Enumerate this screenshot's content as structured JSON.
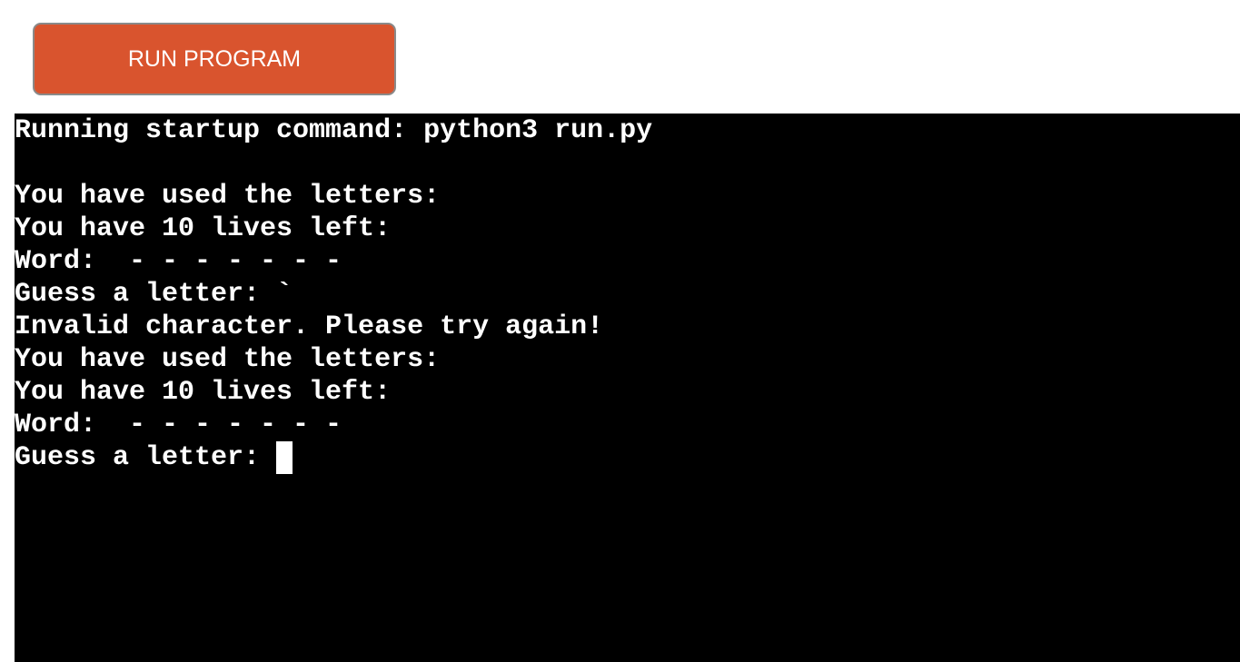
{
  "toolbar": {
    "run_label": "RUN PROGRAM"
  },
  "terminal": {
    "lines": [
      "Running startup command: python3 run.py",
      "",
      "You have used the letters:",
      "You have 10 lives left:",
      "Word:  - - - - - - -",
      "Guess a letter: `",
      "Invalid character. Please try again!",
      "You have used the letters:",
      "You have 10 lives left:",
      "Word:  - - - - - - -"
    ],
    "prompt": "Guess a letter: "
  },
  "colors": {
    "button_bg": "#d9542e",
    "terminal_bg": "#000000",
    "terminal_fg": "#ffffff"
  }
}
